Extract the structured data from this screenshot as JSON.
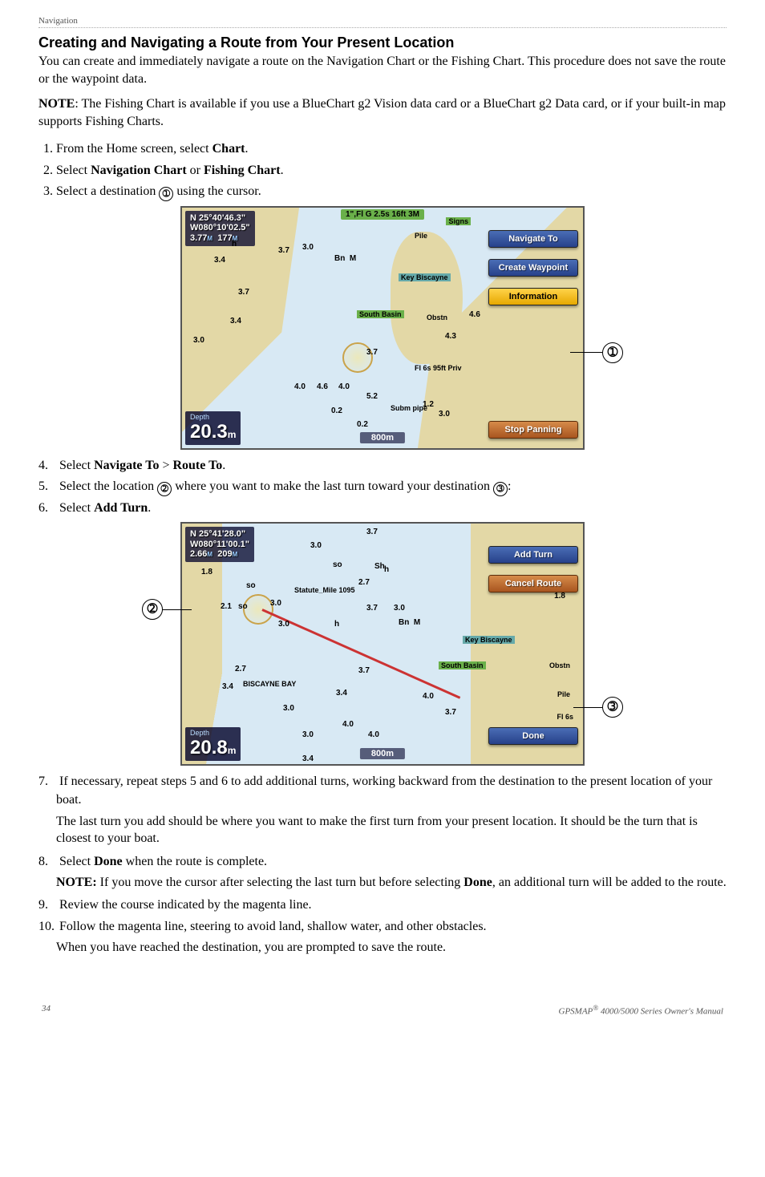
{
  "header": {
    "section": "Navigation"
  },
  "title": "Creating and Navigating a Route from Your Present Location",
  "intro": "You can create and immediately navigate a route on the Navigation Chart or the Fishing Chart. This procedure does not save the route or the waypoint data.",
  "note_label": "NOTE",
  "note_text": ": The Fishing Chart is available if you use a BlueChart g2 Vision data card or a BlueChart g2 Data card, or if your built-in map supports Fishing Charts.",
  "step1_pre": "From the Home screen, select ",
  "step1_b": "Chart",
  "step1_post": ".",
  "step2_pre": "Select ",
  "step2_b1": "Navigation Chart",
  "step2_mid": " or ",
  "step2_b2": "Fishing Chart",
  "step2_post": ".",
  "step3_pre": "Select a destination ",
  "step3_post": " using the cursor.",
  "callout1": "➀",
  "callout2": "➁",
  "callout3": "➂",
  "fig1": {
    "coord_l1": "N  25°40'46.3\"",
    "coord_l2": "W080°10'02.5\"",
    "coord_l3_a": "3.77",
    "coord_l3_b": "M",
    "coord_l3_c": "177",
    "coord_l3_d": "M",
    "depth_label": "Depth",
    "depth_val": "20.3",
    "depth_unit": "m",
    "btn_nav": "Navigate To",
    "btn_wp": "Create Waypoint",
    "btn_info": "Information",
    "btn_stop": "Stop Panning",
    "scale": "800m",
    "topstrip": "1\",Fl G 2.5s 16ft 3M",
    "lbl_pile": "Pile",
    "lbl_key": "Key Biscayne",
    "lbl_sb": "South Basin",
    "lbl_fl": "Fl 6s 95ft Priv",
    "lbl_subm": "Subm pipe",
    "lbl_obst": "Obstn",
    "lbl_signs": "Signs",
    "callout": "➀"
  },
  "step4_pre": "Select ",
  "step4_b1": "Navigate To",
  "step4_mid": " > ",
  "step4_b2": "Route To",
  "step4_post": ".",
  "step5_pre": "Select the location ",
  "step5_mid": " where you want to make the last turn toward your destination ",
  "step5_post": ":",
  "step6_pre": "Select ",
  "step6_b": "Add Turn",
  "step6_post": ".",
  "fig2": {
    "coord_l1": "N  25°41'28.0\"",
    "coord_l2": "W080°11'00.1\"",
    "coord_l3_a": "2.66",
    "coord_l3_b": "M",
    "coord_l3_c": "209",
    "coord_l3_d": "M",
    "depth_label": "Depth",
    "depth_val": "20.8",
    "depth_unit": "m",
    "btn_add": "Add Turn",
    "btn_cancel": "Cancel Route",
    "btn_done": "Done",
    "scale": "800m",
    "lbl_mile": "Statute_Mile 1095",
    "lbl_bay": "BISCAYNE BAY",
    "lbl_key": "Key Biscayne",
    "lbl_sb": "South Basin",
    "lbl_obst": "Obstn",
    "lbl_pile": "Pile",
    "lbl_fl": "Fl 6s",
    "callout_left": "➁",
    "callout_right": "➂"
  },
  "step7": "If necessary, repeat steps 5 and 6 to add additional turns, working backward from the destination to the present location of your boat.",
  "step7_sub": "The last turn you add should be where you want to make the first turn from your present location. It should be the turn that is closest to your boat.",
  "step8_pre": "Select ",
  "step8_b": "Done",
  "step8_post": " when the route is complete.",
  "step8_note_label": "NOTE:",
  "step8_note_a": " If you move the cursor after selecting the last turn but before selecting ",
  "step8_note_b": "Done",
  "step8_note_c": ", an additional turn will be added to the route.",
  "step9": "Review the course indicated by the magenta line.",
  "step10": "Follow the magenta line, steering to avoid land, shallow water, and other obstacles.",
  "step10_sub": "When you have reached the destination, you are prompted to save the route.",
  "footer": {
    "page": "34",
    "product_a": "GPSMAP",
    "product_sup": "®",
    "product_b": " 4000/5000 Series Owner's Manual"
  }
}
